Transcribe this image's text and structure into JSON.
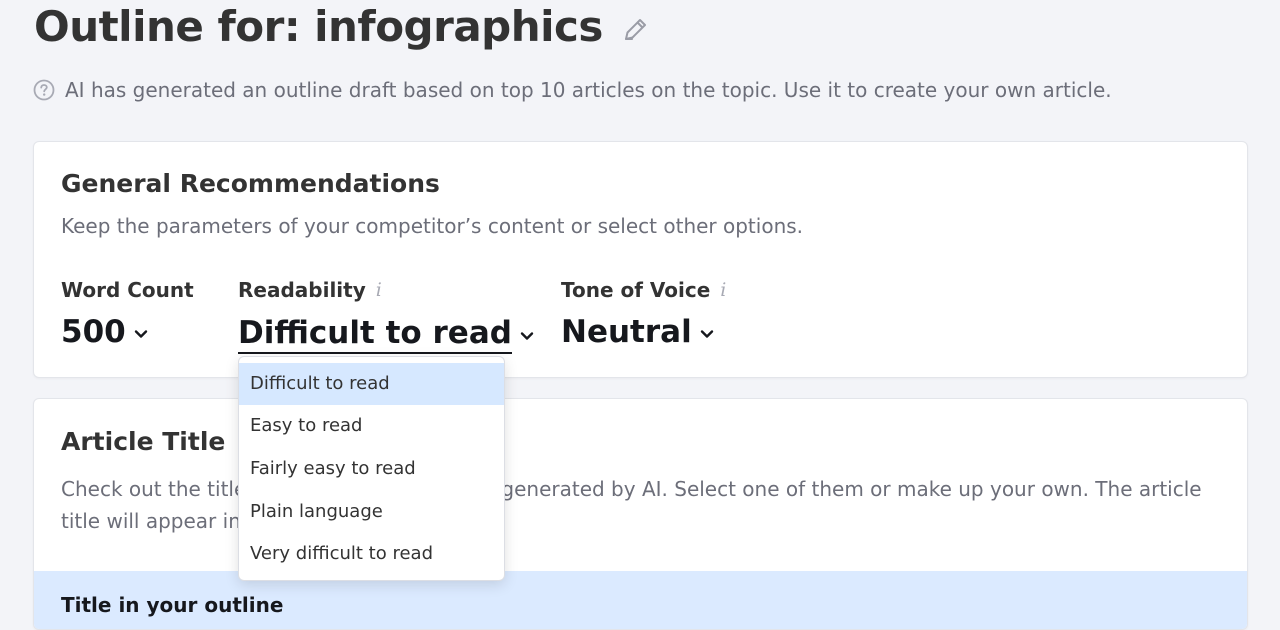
{
  "header": {
    "title_prefix": "Outline for:",
    "topic": "infographics",
    "edit_icon": "pencil-icon",
    "info_icon": "question-circle-icon",
    "info_text": "AI has generated an outline draft based on top 10 articles on the topic. Use it to create your own article."
  },
  "general": {
    "title": "General Recommendations",
    "description": "Keep the parameters of your competitor’s content or select other options.",
    "word_count": {
      "label": "Word Count",
      "value": "500"
    },
    "readability": {
      "label": "Readability",
      "info": "i",
      "value": "Difficult to read"
    },
    "tone": {
      "label": "Tone of Voice",
      "info": "i",
      "value": "Neutral"
    }
  },
  "readability_dropdown": {
    "options": [
      "Difficult to read",
      "Easy to read",
      "Fairly easy to read",
      "Plain language",
      "Very difficult to read"
    ],
    "selected": "Difficult to read"
  },
  "article_title": {
    "title": "Article Title",
    "description": "Check out the titles used by competitors or generated by AI. Select one of them or make up your own. The article title will appear in your outline.",
    "banner_text": "Title in your outline"
  },
  "colors": {
    "background": "#f3f4f8",
    "selected_option": "#d6e8ff",
    "banner": "#dbeaff",
    "text_dark": "#333333",
    "text_muted": "#6c6e79"
  }
}
